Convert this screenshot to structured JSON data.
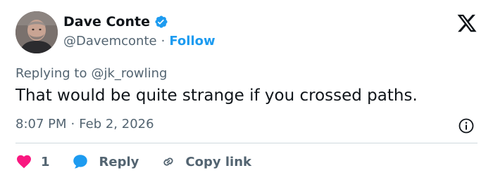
{
  "author": {
    "name": "Dave Conte",
    "handle": "@Davemconte",
    "separator": "·",
    "follow_label": "Follow"
  },
  "reply_context": {
    "prefix": "Replying to",
    "mention": "@jk_rowling"
  },
  "tweet": {
    "text": "That would be quite strange if you crossed paths.",
    "time": "8:07 PM",
    "separator": "·",
    "date": "Feb 2, 2026"
  },
  "actions": {
    "like_count": "1",
    "reply_label": "Reply",
    "copy_label": "Copy link"
  },
  "icons": {
    "verified": "verified-badge-icon",
    "logo": "x-logo-icon",
    "info": "info-icon",
    "like": "heart-icon",
    "reply": "speech-bubble-icon",
    "copy": "link-icon"
  },
  "colors": {
    "accent": "#1d9bf0",
    "like": "#f91880",
    "text": "#0f1419",
    "secondary": "#536471"
  }
}
